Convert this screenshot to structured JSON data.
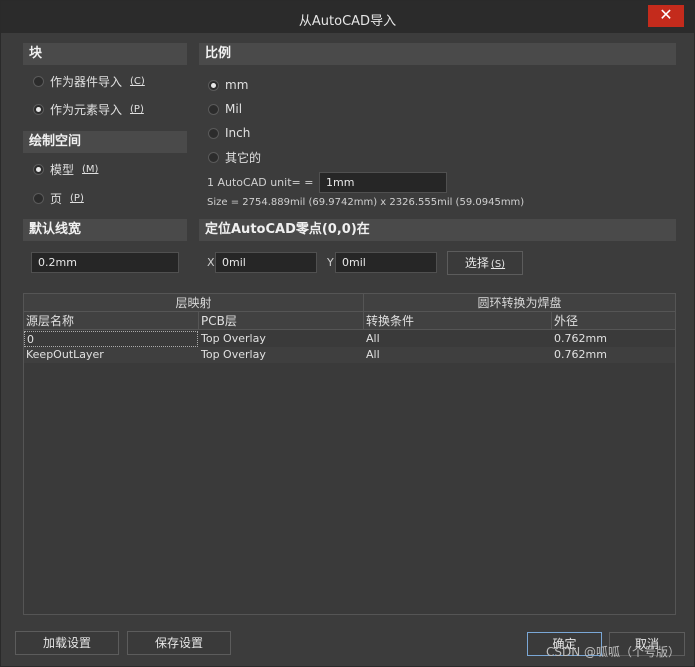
{
  "window": {
    "title": "从AutoCAD导入",
    "close": "✕"
  },
  "block": {
    "header": "块",
    "options": [
      {
        "label": "作为器件导入",
        "accel": "(C)",
        "selected": false
      },
      {
        "label": "作为元素导入",
        "accel": "(P)",
        "selected": true
      }
    ]
  },
  "space": {
    "header": "绘制空间",
    "options": [
      {
        "label": "模型",
        "accel": "(M)",
        "selected": true
      },
      {
        "label": "页",
        "accel": "(P)",
        "selected": false
      }
    ]
  },
  "linewidth": {
    "header": "默认线宽",
    "value": "0.2mm"
  },
  "scale": {
    "header": "比例",
    "options": [
      {
        "label": "mm",
        "selected": true
      },
      {
        "label": "Mil",
        "selected": false
      },
      {
        "label": "Inch",
        "selected": false
      },
      {
        "label": "其它的",
        "selected": false
      }
    ],
    "unit_label": "1 AutoCAD unit= =",
    "unit_value": "1mm",
    "size_text": "Size = 2754.889mil (69.9742mm) x 2326.555mil (59.0945mm)"
  },
  "origin": {
    "header": "定位AutoCAD零点(0,0)在",
    "x_label": "X",
    "x_value": "0mil",
    "y_label": "Y",
    "y_value": "0mil",
    "select_label": "选择",
    "select_accel": "(S)"
  },
  "table": {
    "band_left": "层映射",
    "band_right": "圆环转换为焊盘",
    "columns": [
      "源层名称",
      "PCB层",
      "转换条件",
      "外径"
    ],
    "rows": [
      [
        "0",
        "Top Overlay",
        "All",
        "0.762mm"
      ],
      [
        "KeepOutLayer",
        "Top Overlay",
        "All",
        "0.762mm"
      ]
    ]
  },
  "footer": {
    "load": "加载设置",
    "save": "保存设置",
    "ok": "确定",
    "cancel": "取消",
    "watermark": "CSDN @呱呱（个号版）"
  }
}
